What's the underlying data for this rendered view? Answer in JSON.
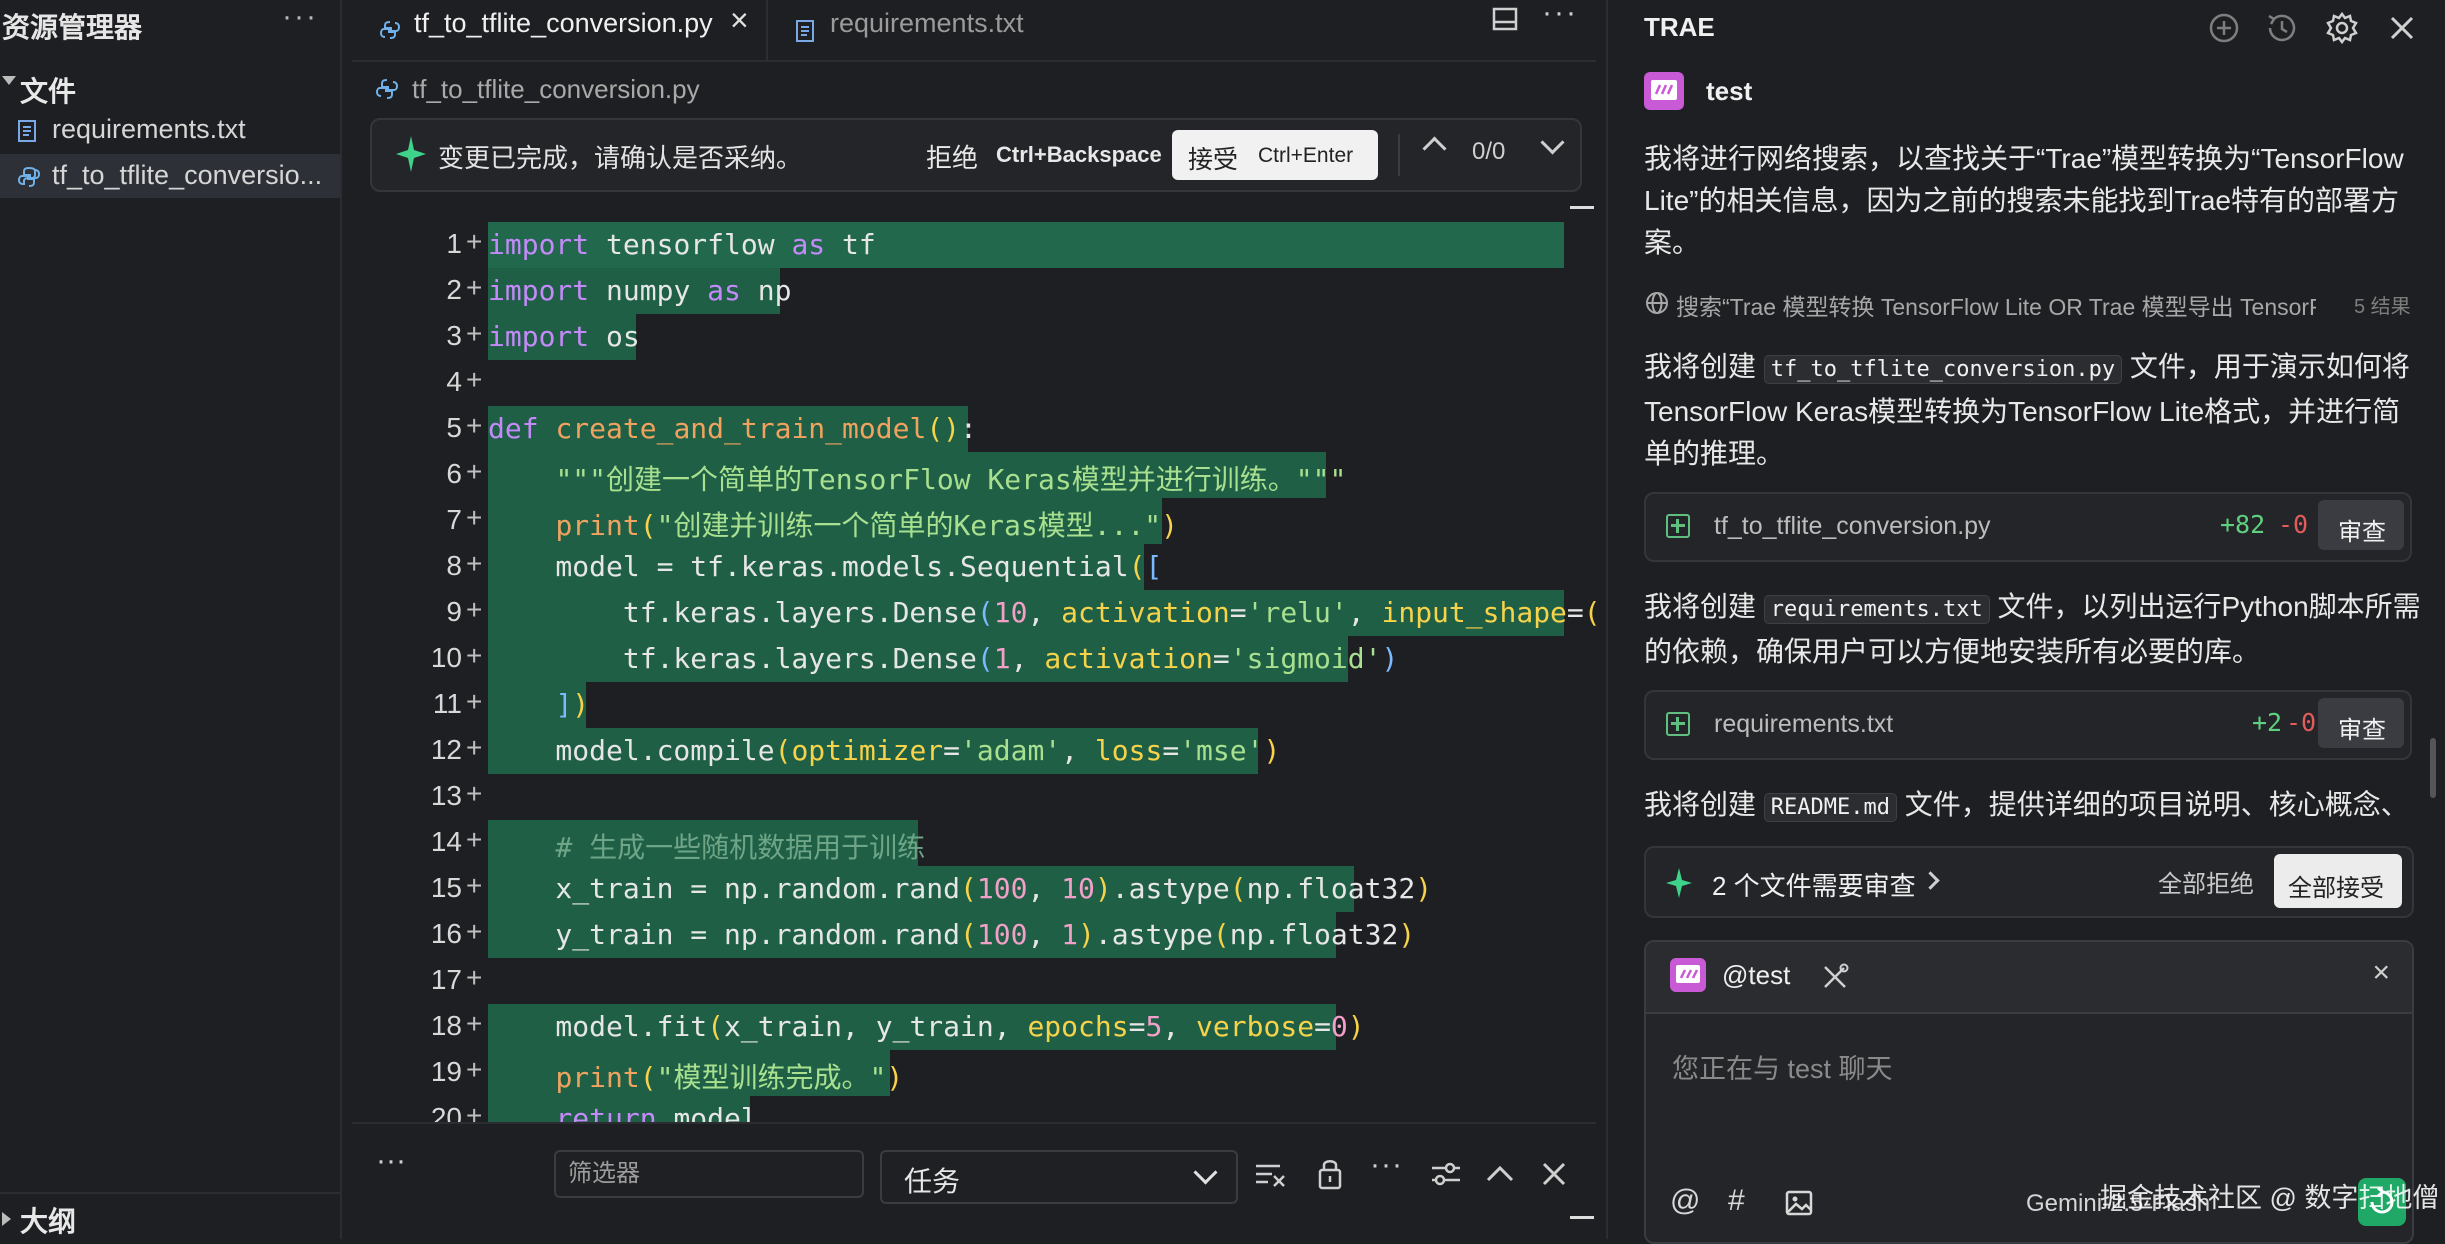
{
  "explorer": {
    "title": "资源管理器",
    "more": "···",
    "section_files": "文件",
    "files": [
      {
        "name": "requirements.txt"
      },
      {
        "name": "tf_to_tflite_conversio..."
      }
    ],
    "section_outline": "大纲"
  },
  "editor": {
    "tabs": [
      {
        "label": "tf_to_tflite_conversion.py"
      },
      {
        "label": "requirements.txt"
      }
    ],
    "breadcrumb": "tf_to_tflite_conversion.py",
    "accept_bar": {
      "message": "变更已完成，请确认是否采纳。",
      "reject_label": "拒绝",
      "reject_shortcut": "Ctrl+Backspace",
      "accept_label": "接受",
      "accept_shortcut": "Ctrl+Enter",
      "counter": "0/0"
    },
    "line_numbers": [
      "1",
      "2",
      "3",
      "4",
      "5",
      "6",
      "7",
      "8",
      "9",
      "10",
      "11",
      "12",
      "13",
      "14",
      "15",
      "16",
      "17",
      "18",
      "19",
      "20"
    ],
    "panel": {
      "filter_placeholder": "筛选器",
      "task_select": "任务"
    }
  },
  "chat": {
    "brand": "TRAE",
    "agent_name": "test",
    "messages": [
      "我将进行网络搜索，以查找关于“Trae”模型转换为“TensorFlow Lite”的相关信息，因为之前的搜索未能找到Trae特有的部署方案。"
    ],
    "search": {
      "query": "搜索“Trae 模型转换 TensorFlow Lite OR Trae 模型导出 TensorFl...",
      "count": "5 结果"
    },
    "msg2": {
      "pre": "我将创建 ",
      "code": "tf_to_tflite_conversion.py",
      "post": " 文件，用于演示如何将TensorFlow Keras模型转换为TensorFlow Lite格式，并进行简单的推理。"
    },
    "card1": {
      "name": "tf_to_tflite_conversion.py",
      "add": "+82",
      "del": "-0",
      "review": "审查"
    },
    "msg3": {
      "pre": "我将创建 ",
      "code": "requirements.txt",
      "post": " 文件，以列出运行Python脚本所需的依赖，确保用户可以方便地安装所有必要的库。"
    },
    "card2": {
      "name": "requirements.txt",
      "add": "+2",
      "del": "-0",
      "review": "审查"
    },
    "msg4": {
      "pre": "我将创建 ",
      "code": "README.md",
      "post": " 文件，提供详细的项目说明、核心概念、"
    },
    "review_bar": {
      "message": "2 个文件需要审查",
      "reject_all": "全部拒绝",
      "accept_all": "全部接受"
    },
    "input": {
      "mention": "@test",
      "placeholder": "您正在与 test 聊天",
      "model": "Gemini-2.5-Flash"
    }
  },
  "watermark": "掘金技术社区 @ 数字扫地僧",
  "colors": {
    "added_bg": "#1e5f46",
    "accent_green": "#1fa866",
    "agent_icon": "#c95ad6"
  }
}
